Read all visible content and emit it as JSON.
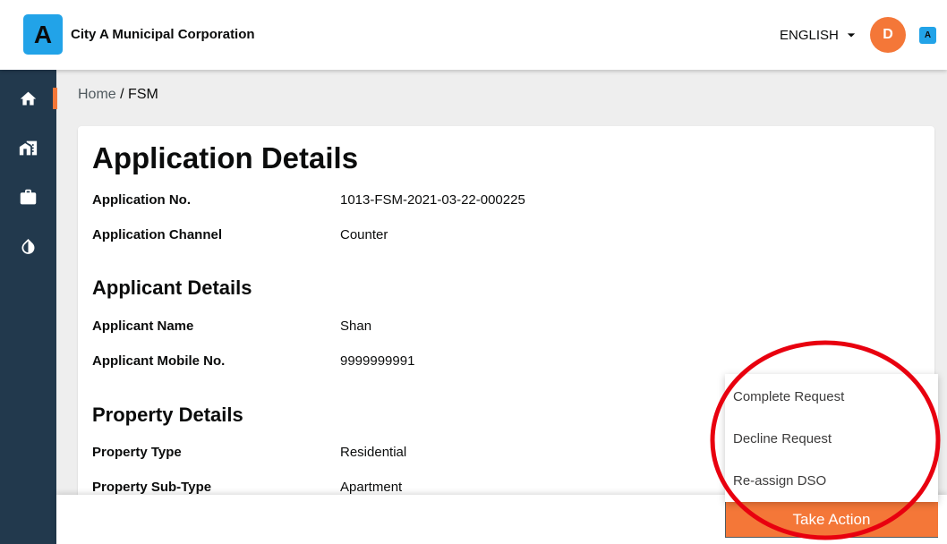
{
  "theme": {
    "accent": "#f47738",
    "sidebar": "#22394d",
    "logo": "#22a3e8",
    "annotation": "#e8000f"
  },
  "header": {
    "logo_letter": "A",
    "org_name": "City A Municipal Corporation",
    "language": "ENGLISH",
    "user_initial": "D",
    "badge_letter": "A"
  },
  "sidebar": {
    "items": [
      {
        "icon": "home-icon",
        "active": true
      },
      {
        "icon": "home-work-icon",
        "active": false
      },
      {
        "icon": "briefcase-icon",
        "active": false
      },
      {
        "icon": "water-drop-icon",
        "active": false
      }
    ]
  },
  "breadcrumb": {
    "home": "Home",
    "separator": "/",
    "current": "FSM"
  },
  "application": {
    "title": "Application Details",
    "rows": [
      {
        "label": "Application No.",
        "value": "1013-FSM-2021-03-22-000225"
      },
      {
        "label": "Application Channel",
        "value": "Counter"
      }
    ]
  },
  "applicant": {
    "heading": "Applicant Details",
    "rows": [
      {
        "label": "Applicant Name",
        "value": "Shan"
      },
      {
        "label": "Applicant Mobile No.",
        "value": "9999999991"
      }
    ]
  },
  "property": {
    "heading": "Property Details",
    "rows": [
      {
        "label": "Property Type",
        "value": "Residential"
      },
      {
        "label": "Property Sub-Type",
        "value": "Apartment"
      }
    ]
  },
  "action_menu": {
    "items": [
      "Complete Request",
      "Decline Request",
      "Re-assign DSO"
    ],
    "button_label": "Take Action"
  }
}
